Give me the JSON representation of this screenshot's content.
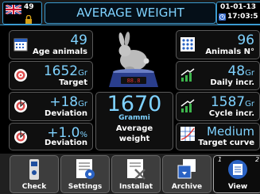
{
  "header": {
    "title": "AVERAGE WEIGHT",
    "language_number": "49",
    "date": "01-01-13",
    "time": "17:03:5"
  },
  "left_panels": [
    {
      "value": "49",
      "unit": "",
      "label": "Age animals",
      "icon": "calendar-icon"
    },
    {
      "value": "1652",
      "unit": "Gr",
      "label": "Target",
      "icon": "target-icon"
    },
    {
      "value": "+18",
      "unit": "Gr",
      "label": "Deviation",
      "icon": "deviation-icon"
    },
    {
      "value": "+1.0",
      "unit": "%",
      "label": "Deviation",
      "icon": "deviation-percent-icon"
    }
  ],
  "right_panels": [
    {
      "value": "96",
      "unit": "",
      "label": "Animals N°",
      "icon": "animals-grid-icon"
    },
    {
      "value": "48",
      "unit": "Gr",
      "label": "Daily incr.",
      "icon": "daily-increase-icon"
    },
    {
      "value": "1587",
      "unit": "Gr",
      "label": "Cycle incr.",
      "icon": "cycle-increase-icon"
    },
    {
      "value": "Medium",
      "unit": "",
      "label": "Target curve",
      "icon": "curve-icon"
    }
  ],
  "center": {
    "value": "1670",
    "unit": "Grammi",
    "label_line1": "Average",
    "label_line2": "weight"
  },
  "nav": [
    {
      "label": "Check",
      "icon": "check-device-icon",
      "active": false
    },
    {
      "label": "Settings",
      "icon": "settings-icon",
      "active": false
    },
    {
      "label": "Installat",
      "icon": "installation-icon",
      "active": false
    },
    {
      "label": "Archive",
      "icon": "archive-icon",
      "active": false
    },
    {
      "label": "View",
      "icon": "view-icon",
      "active": true
    }
  ],
  "pager": {
    "current": "1",
    "next": "2"
  },
  "colors": {
    "accent": "#7fd2ff",
    "border": "#3a9ad0"
  }
}
